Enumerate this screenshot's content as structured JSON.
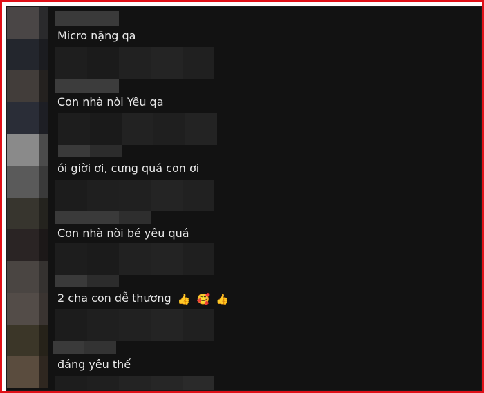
{
  "comments": [
    {
      "text": "Micro nặng qa"
    },
    {
      "text": "Con nhà nòi Yêu qa"
    },
    {
      "text": "ói giời ơi, cưng quá con ơi"
    },
    {
      "text": "Con nhà nòi bé yêu quá"
    },
    {
      "text": "2 cha con dễ thương",
      "emojis": [
        "👍",
        "🥰",
        "👍"
      ]
    },
    {
      "text": "đáng yêu thế"
    }
  ],
  "colors": {
    "frame_border": "#e01018",
    "background": "#121212",
    "text": "#e9e9e9"
  },
  "icons": {
    "thumbs_up": "thumbs-up-icon",
    "smiling_hearts": "smiling-face-hearts-icon"
  }
}
